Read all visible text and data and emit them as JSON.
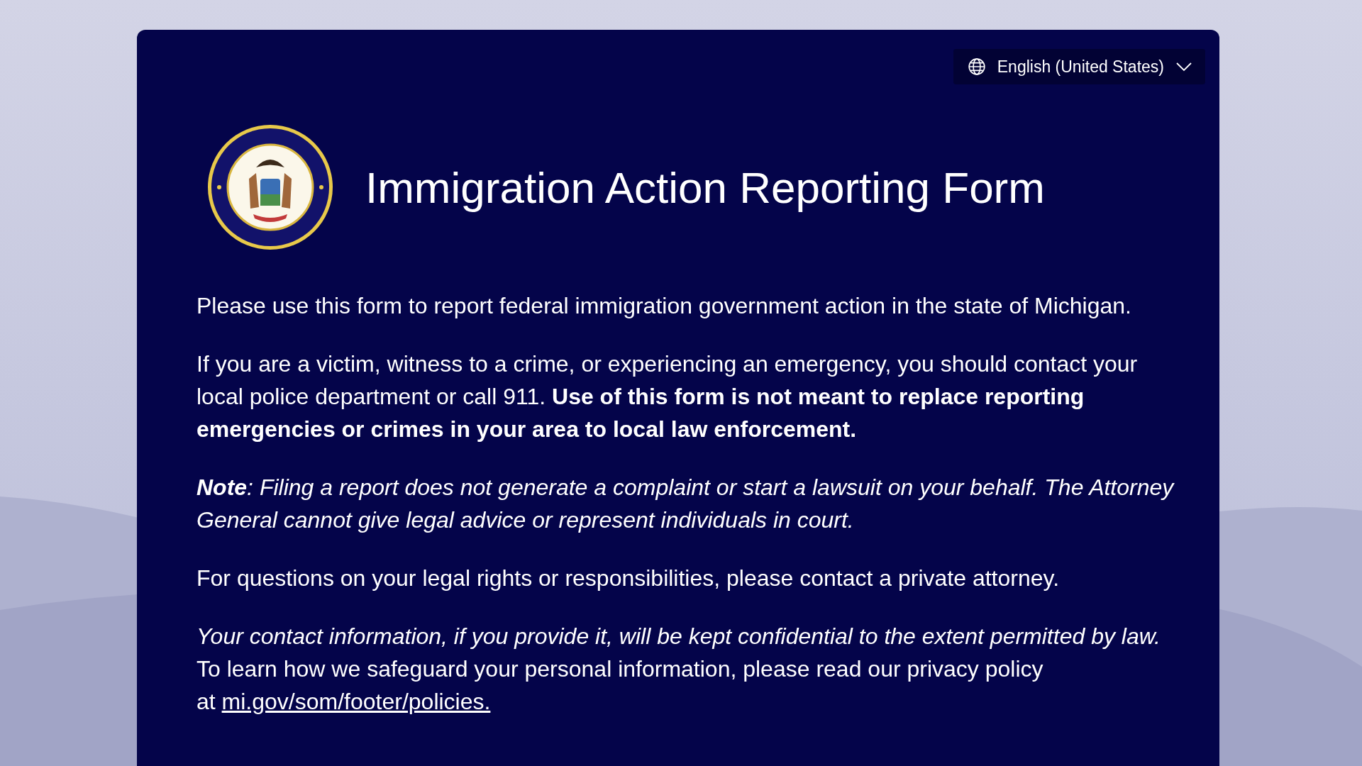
{
  "language_selector": {
    "label": "English (United States)"
  },
  "title": "Immigration Action Reporting Form",
  "paragraphs": [
    {
      "kind": "plain",
      "text": "Please use this form to report federal immigration government action in the state of Michigan."
    },
    {
      "kind": "plain",
      "text": "If you are a victim, witness to a crime, or experiencing an emergency, you should contact your local police department or call 911. **Use of this form is not meant to replace reporting emergencies or crimes in your area to local law enforcement.**"
    },
    {
      "kind": "italic",
      "text": "**Note**: Filing a report does not generate a complaint or start a lawsuit on your behalf. The Attorney General cannot give legal advice or represent individuals in court."
    },
    {
      "kind": "plain",
      "text": "For questions on your legal rights or responsibilities, please contact a private attorney."
    }
  ],
  "privacy": {
    "notice": "Your contact information, if you provide it, will be kept confidential to the extent permitted by law.",
    "text": "To learn how we safeguard your personal information, please read our privacy policy",
    "link_prefix": "at",
    "link": "mi.gov/som/footer/policies."
  }
}
